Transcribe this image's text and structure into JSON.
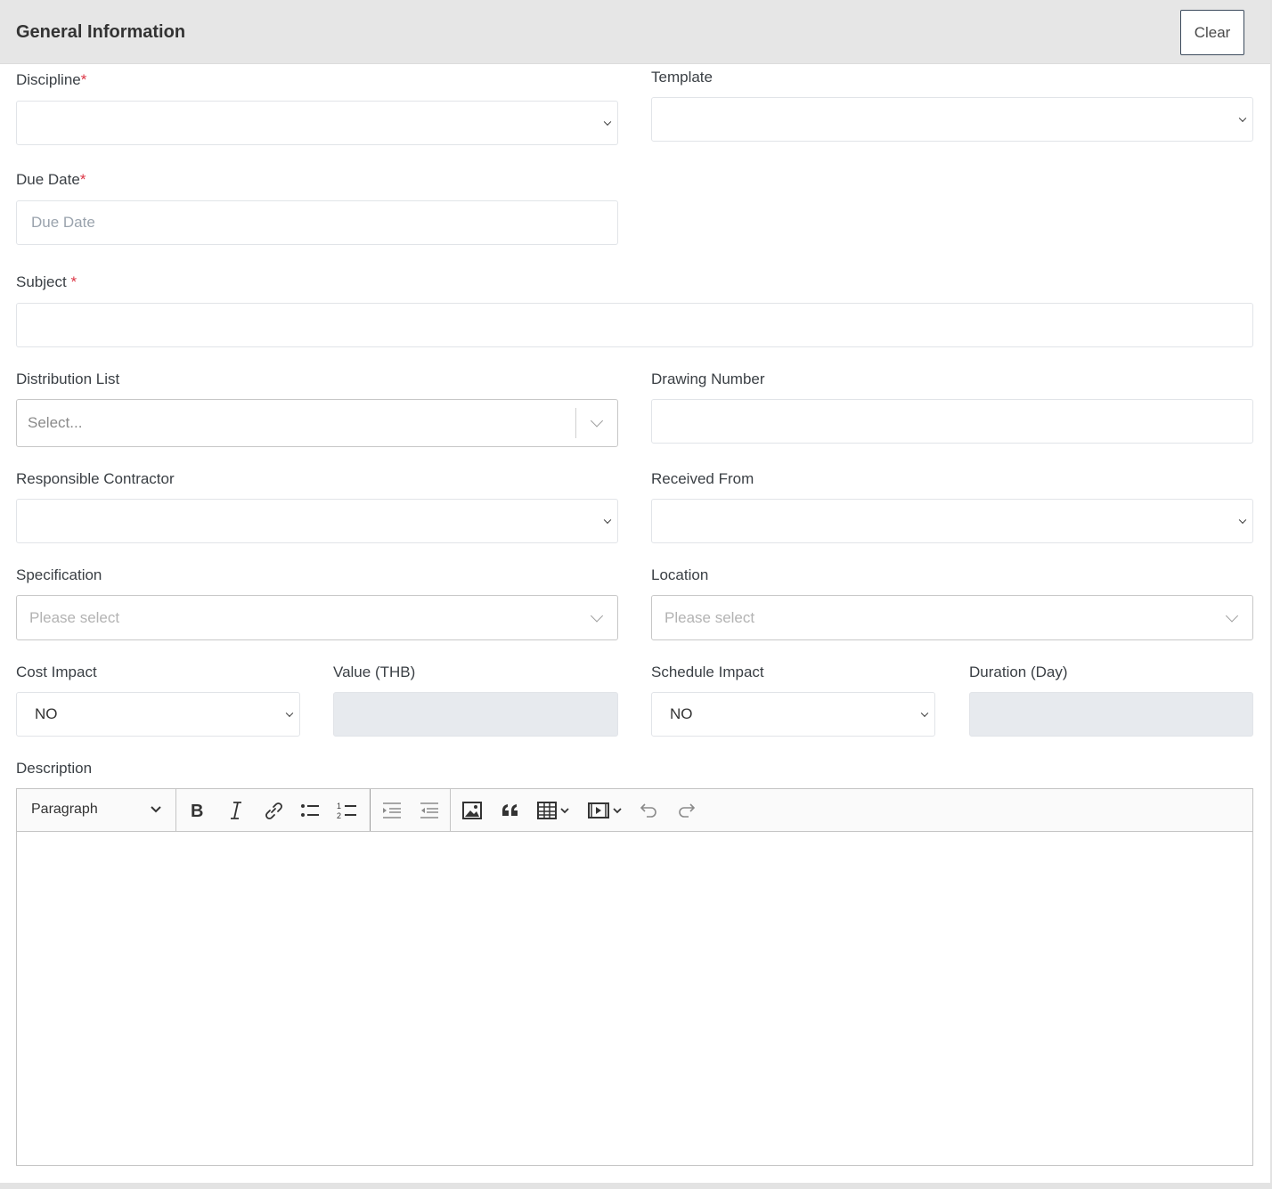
{
  "header": {
    "title": "General Information",
    "clear_label": "Clear"
  },
  "fields": {
    "discipline": {
      "label": "Discipline",
      "required_mark": "*",
      "value": ""
    },
    "template": {
      "label": "Template",
      "value": ""
    },
    "due_date": {
      "label": "Due Date",
      "required_mark": "*",
      "placeholder": "Due Date"
    },
    "subject": {
      "label": "Subject ",
      "required_mark": "*",
      "value": ""
    },
    "distribution_list": {
      "label": "Distribution List",
      "placeholder": "Select..."
    },
    "drawing_number": {
      "label": "Drawing Number",
      "value": ""
    },
    "responsible_contractor": {
      "label": "Responsible Contractor",
      "value": ""
    },
    "received_from": {
      "label": "Received From",
      "value": ""
    },
    "specification": {
      "label": "Specification",
      "placeholder": "Please select"
    },
    "location": {
      "label": "Location",
      "placeholder": "Please select"
    },
    "cost_impact": {
      "label": "Cost Impact",
      "value": "NO"
    },
    "value_thb": {
      "label": "Value (THB)",
      "value": ""
    },
    "schedule_impact": {
      "label": "Schedule Impact",
      "value": "NO"
    },
    "duration_day": {
      "label": "Duration (Day)",
      "value": ""
    },
    "description": {
      "label": "Description"
    }
  },
  "editor": {
    "block_format": "Paragraph",
    "toolbar_icons": [
      "bold-icon",
      "italic-icon",
      "link-icon",
      "bulleted-list-icon",
      "numbered-list-icon",
      "decrease-indent-icon",
      "increase-indent-icon",
      "insert-image-icon",
      "block-quote-icon",
      "insert-table-icon",
      "insert-media-icon",
      "undo-icon",
      "redo-icon"
    ]
  },
  "colors": {
    "required": "#dc3545",
    "header_bg": "#e6e6e6",
    "disabled_bg": "#e7eaee"
  }
}
